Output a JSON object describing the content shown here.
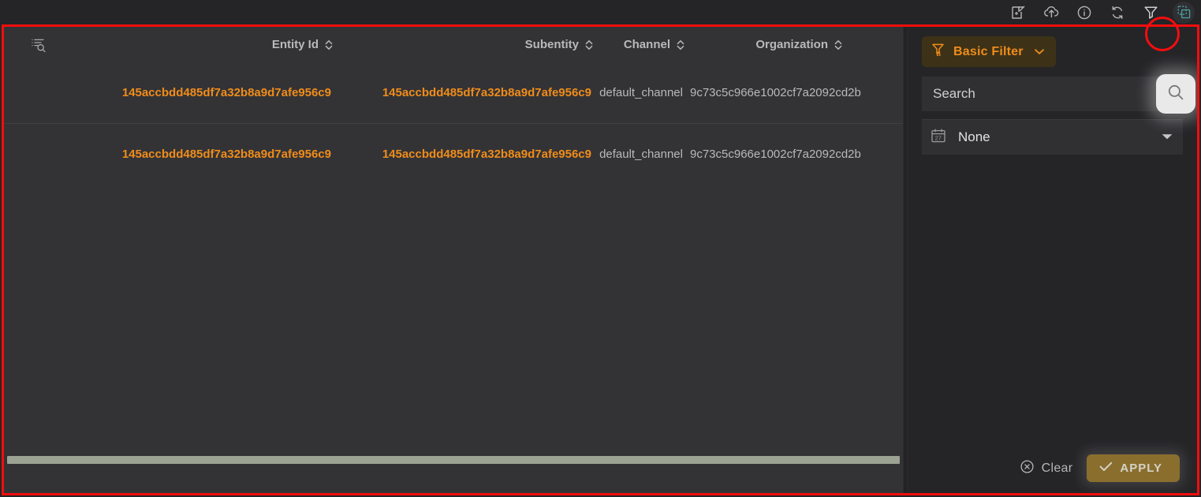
{
  "toolbar": {
    "icons": [
      {
        "name": "export-window-icon",
        "title": "Open in new window"
      },
      {
        "name": "cloud-upload-icon",
        "title": "Upload"
      },
      {
        "name": "info-icon",
        "title": "Info"
      },
      {
        "name": "refresh-icon",
        "title": "Refresh"
      },
      {
        "name": "filter-icon",
        "title": "Filter"
      },
      {
        "name": "duplicate-icon",
        "title": "Duplicate"
      }
    ],
    "active_icon": "duplicate-icon",
    "highlighted_icon": "filter-icon",
    "active_color": "#4a9c9c"
  },
  "table": {
    "row_search_icon": "list-search-icon",
    "columns": [
      {
        "label": "Entity Id",
        "sortable": true
      },
      {
        "label": "Subentity",
        "sortable": true
      },
      {
        "label": "Channel",
        "sortable": true
      },
      {
        "label": "Organization",
        "sortable": true
      }
    ],
    "rows": [
      {
        "entity_id": "145accbdd485df7a32b8a9d7afe956c9",
        "subentity": "145accbdd485df7a32b8a9d7afe956c9",
        "channel": "default_channel",
        "organization": "9c73c5c966e1002cf7a2092cd2b"
      },
      {
        "entity_id": "145accbdd485df7a32b8a9d7afe956c9",
        "subentity": "145accbdd485df7a32b8a9d7afe956c9",
        "channel": "default_channel",
        "organization": "9c73c5c966e1002cf7a2092cd2b"
      }
    ],
    "entity_color": "#f08c1a",
    "scrollbar_thumb_color": "#9da392"
  },
  "filter_panel": {
    "mode_button": {
      "label": "Basic Filter",
      "icon": "filter-b-icon",
      "chevron": "chevron-down-icon",
      "text_color": "#f08c1a",
      "bg_color": "#3d3218"
    },
    "search": {
      "placeholder": "Search",
      "value": "",
      "button_icon": "search-icon"
    },
    "date_select": {
      "icon": "calendar-27-icon",
      "value": "None",
      "chevron": "chevron-down-icon"
    },
    "actions": {
      "clear_label": "Clear",
      "clear_icon": "circle-x-icon",
      "apply_label": "APPLY",
      "apply_icon": "check-icon",
      "apply_bg": "#8a6e2e"
    }
  },
  "annotations": {
    "rect_color": "#f40d0d",
    "circle_target": "filter-icon"
  }
}
